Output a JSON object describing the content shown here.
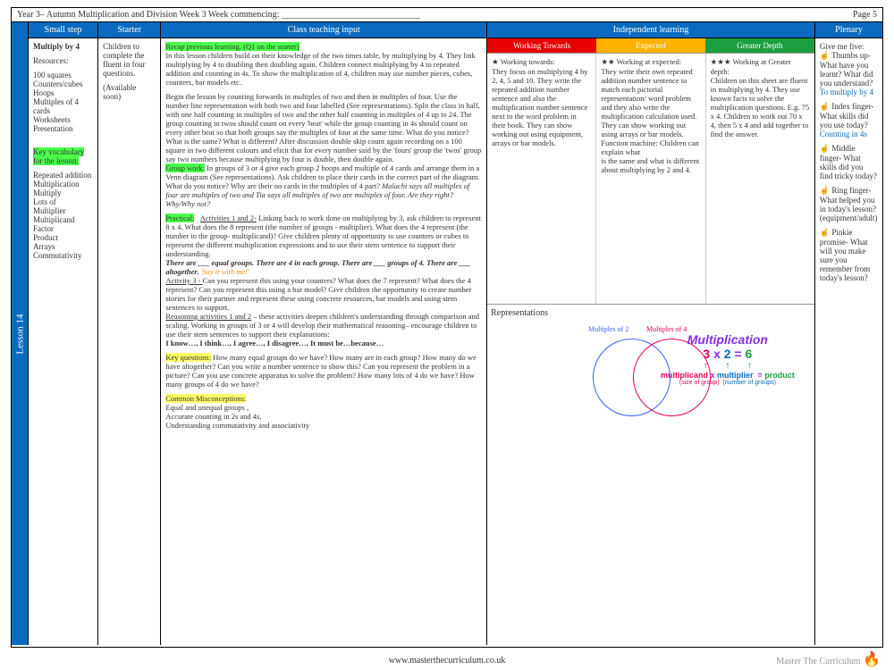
{
  "hdr": {
    "left": "Year 3– Autumn Multiplication and Division Week 3    Week  commencing: _______________________________",
    "right": "Page 5"
  },
  "lesson": "Lesson 14",
  "cols": {
    "c1": "Small step",
    "c2": "Starter",
    "c3": "Class teaching input",
    "c4": "Independent learning",
    "c5": "Plenary"
  },
  "c1": {
    "t": "Multiply by 4",
    "r": "Resources:",
    "rl": "100 squares\nCounters/cubes\nHoops\nMultiples of 4 cards\nWorksheets\nPresentation",
    "kv": "Key vocabulary",
    "kv2": "for the lesson:",
    "vl": "Repeated addition\nMultiplication\nMultiply\nLots of\nMultiplier\nMultiplicand\nFactor\nProduct\nArrays\nCommutativity"
  },
  "c2": {
    "t": "Children to complete the fluent in four questions.",
    "a": "(Available soon)"
  },
  "c3": {
    "recap": "Recap previous learning. (Q1 on the starter)",
    "p1": "In this lesson children build on their knowledge of the two times table, by multiplying by 4.  They link multiplying by 4 to doubling then doubling again. Children connect multiplying by 4 to repeated addition and counting in 4s.  To show the multiplication of 4, children may use number pieces, cubes, counters, bar models etc.",
    "p2": "Begin the lesson by counting forwards in multiples of two and then in multiples of four.  Use the number line representation  with both two and four labelled (See representations). Split the class in half, with one half counting in multiples of two and the other half counting in multiples of 4 up to 24.  The group counting in twos should count on every 'beat' while the group counting in 4s should count on every other beat so that both groups say the multiples of four at the same time. What do you notice? What is the same? What is different?    After discussion double skip count again recording on a 100 square in two different colours and elicit that for every number said by the 'fours' group the 'twos' group say two numbers because multiplying by four is double, then double again.",
    "gw": "Group work:",
    "gwt": " In groups of 3 or 4 give each group 2 hoops and multiple of 4 cards and arrange them in a Venn diagram (See representations). Ask children to place their cards in the correct part of the diagram. What do you notice?  Why are their no cards in the multiples of  4 part?   ",
    "gwi": "Malachi says all multiples of four are multiples of two and Tia says all multiples of two are multiples of four. Are they right?  Why/Why not?",
    "pr": "Practical:",
    "pru": "Activities 1 and 2-",
    "prt": "  Linking back to work done on multiplying by 3, ask children to represent 8 x 4. What does the 8 represent (the number of groups - multiplier).  What does the 4 represent (the number in the group- multiplicand)? Give children plenty of opportunity  to use counters or cubes to represent the different multiplication expressions and  to use their stem sentence to support their understanding.",
    "stem": "There are ___ equal groups. There are 4 in each group.  There are ___ groups of 4. There are ___ altogether.",
    "say": "'Say it with me!'",
    "a3": "Activity 3 - ",
    "a3t": "Can you represent this using your counters?  What does the 7 represent? What does the 4 represent?  Can you represent this using a bar model? Give children the opportunity to create number stories for their partner and represent these using concrete resources, bar models and using stem sentences to support.",
    "ra": "Reasoning activities 1 and 2",
    "rat": " – these activities deepen children's understanding through comparison and scaling.  Working in groups of 3 or 4 will develop their mathematical reasoning– encourage children to use their stem sentences to support their explanations:",
    "rs": "I know…, I think…, I agree…, I disagree…, It must be…because…",
    "kq": "Key questions:",
    "kqt": " How many equal groups do we have? How many are in each group? How many do we have altogether? Can you write a number sentence to show this? Can you represent the problem in a picture? Can you use concrete apparatus to solve the problem? How many lots of 4 do we have? How many groups of 4 do we have?",
    "cm": "Common Misconceptions:",
    "cmt": "Equal and unequal groups  ,\nAccurate counting in 2s and  4s,\nUnderstanding commutativity and associativity"
  },
  "c4": {
    "wt": "Working Towards",
    "ex": "Expected",
    "gd": "Greater Depth",
    "wtt": "★  Working towards:\nThey focus on multiplying 4 by 2, 4, 5 and 10. They write the repeated addition number sentence and also the multiplication number sentence next to the word problem in their book. They can show working out using equipment, arrays or bar models.",
    "ext": "★★  Working at expected:\nThey write their own repeated addition number sentence to match each pictorial representation/ word problem and they also write the multiplication calculation used. They can show working out using arrays or bar models.\nFunction machine: Children can explain what\nis the same and what is different about multiplying by 2 and 4.",
    "gdt": "★★★ Working at Greater depth:\nChildren on this sheet are fluent in multiplying by 4. They use known facts to solve the multiplication questions. E.g. 75 x 4. Children to work out 70 x 4, then 5 x 4 and add together to find the answer.",
    "rep": "Representations",
    "v1": "Multiples of 2",
    "v2": "Multiples of 4",
    "mt": "Multiplication",
    "me": "3 x 2 = 6",
    "m1": "multiplicand",
    "m2": "multiplier",
    "m3": "product",
    "s1": "(size of group)",
    "s2": "(number of groups)"
  },
  "c5": {
    "t": "Give me five:\n☝ Thumbs up- What have you learnt? What did you understand?",
    "l1": "To multiply by 4",
    "i": "☝ Index finger- What skills did you use today?",
    "l2": "Counting in 4s",
    "m": "☝ Middle finger- What skills did you find tricky today?",
    "r": "☝ Ring finger- What helped you in today's lesson? (equipment/adult)",
    "p": "☝ Pinkie promise- What will you make sure you remember from today's lesson?"
  },
  "footer": "www.masterthecurriculum.co.uk",
  "brand": "Master The Curriculum"
}
